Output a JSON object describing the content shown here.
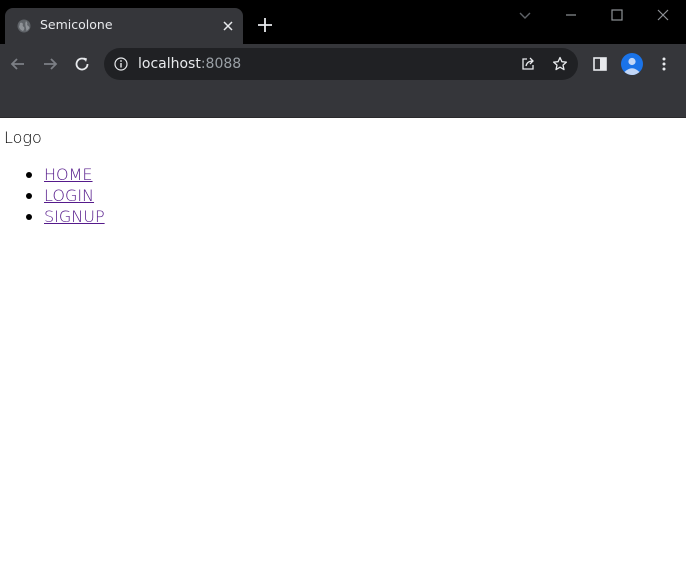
{
  "browser": {
    "tab": {
      "title": "Semicolone"
    },
    "address": {
      "host": "localhost",
      "port": ":8088"
    }
  },
  "page": {
    "logo": "Logo",
    "nav": [
      {
        "label": "HOME"
      },
      {
        "label": "LOGIN"
      },
      {
        "label": "SIGNUP"
      }
    ]
  },
  "colors": {
    "link_visited": "#551a8b",
    "chrome_dark": "#35363a",
    "tabstrip": "#000000",
    "omnibox": "#202124",
    "avatar": "#1a73e8"
  }
}
